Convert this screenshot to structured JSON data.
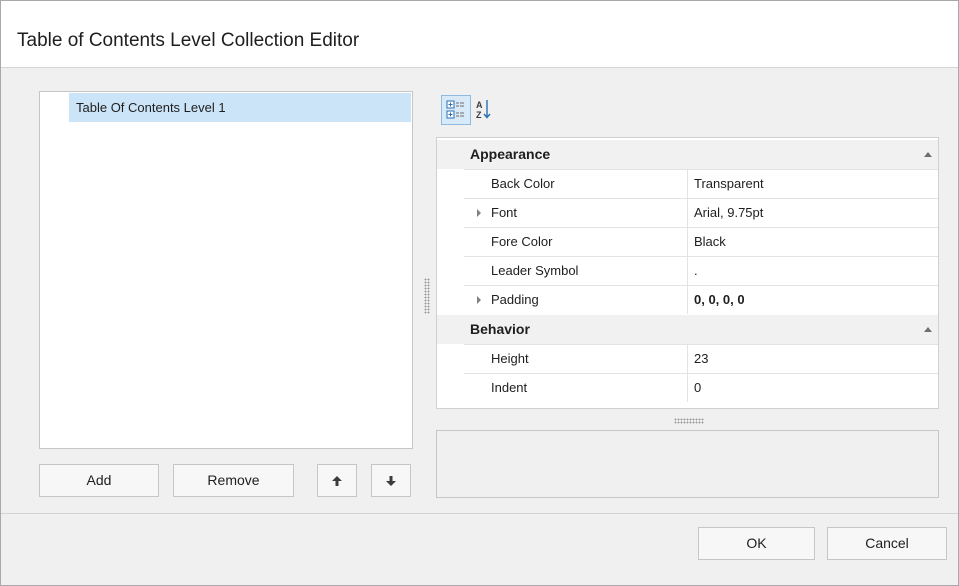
{
  "window": {
    "title": "Table of Contents Level Collection Editor"
  },
  "list": {
    "items": [
      "Table Of Contents Level 1"
    ]
  },
  "list_buttons": {
    "add": "Add",
    "remove": "Remove",
    "move_up_icon": "arrow-up-icon",
    "move_down_icon": "arrow-down-icon"
  },
  "toolbar": {
    "categorized_icon": "categorized-icon",
    "alphabetical_icon": "sort-alpha-icon"
  },
  "property_grid": {
    "categories": [
      {
        "name": "Appearance",
        "properties": [
          {
            "name": "Back Color",
            "value": "Transparent"
          },
          {
            "name": "Font",
            "value": "Arial, 9.75pt"
          },
          {
            "name": "Fore Color",
            "value": "Black"
          },
          {
            "name": "Leader Symbol",
            "value": "."
          },
          {
            "name": "Padding",
            "value": "0, 0, 0, 0"
          }
        ]
      },
      {
        "name": "Behavior",
        "properties": [
          {
            "name": "Height",
            "value": "23"
          },
          {
            "name": "Indent",
            "value": "0"
          }
        ]
      }
    ]
  },
  "footer": {
    "ok": "OK",
    "cancel": "Cancel"
  },
  "colors": {
    "selection": "#cce4f7",
    "accent": "#2b7cd3"
  }
}
